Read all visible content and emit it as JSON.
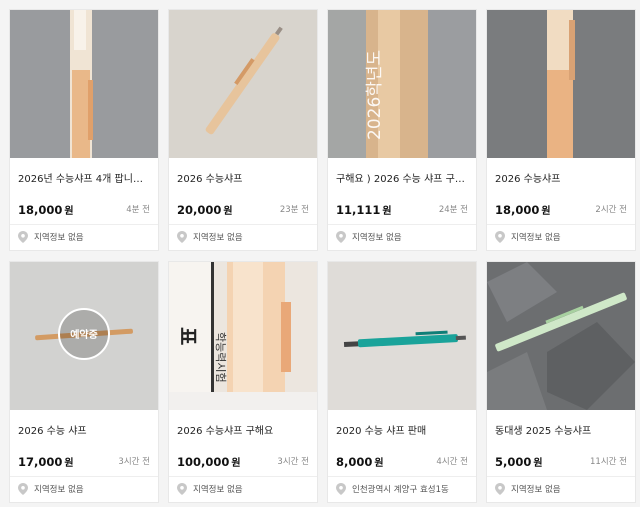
{
  "products": [
    {
      "title": "2026년 수능샤프 4개 팝니다…",
      "price": "18,000",
      "currency": "원",
      "time": "4분 전",
      "location": "지역정보 없음"
    },
    {
      "title": "2026 수능샤프",
      "price": "20,000",
      "currency": "원",
      "time": "23분 전",
      "location": "지역정보 없음"
    },
    {
      "title": "구해요 ) 2026 수능 샤프 구…",
      "price": "11,111",
      "currency": "원",
      "time": "24분 전",
      "location": "지역정보 없음"
    },
    {
      "title": "2026 수능샤프",
      "price": "18,000",
      "currency": "원",
      "time": "2시간 전",
      "location": "지역정보 없음"
    },
    {
      "title": "2026 수능 샤프",
      "price": "17,000",
      "currency": "원",
      "time": "3시간 전",
      "location": "지역정보 없음",
      "badge": "예약중"
    },
    {
      "title": "2026 수능샤프 구해요",
      "price": "100,000",
      "currency": "원",
      "time": "3시간 전",
      "location": "지역정보 없음"
    },
    {
      "title": "2020 수능 샤프 판매",
      "price": "8,000",
      "currency": "원",
      "time": "4시간 전",
      "location": "인천광역시 계양구 효성1동"
    },
    {
      "title": "동대생 2025 수능샤프",
      "price": "5,000",
      "currency": "원",
      "time": "11시간 전",
      "location": "지역정보 없음"
    }
  ],
  "photo_text": {
    "pencil_barrel": "2026학년도",
    "exam_sheet": "학능력시험",
    "exam_mark": "표"
  },
  "colors": {
    "price": "#111111",
    "muted": "#888888",
    "pin": "#c8c8c8"
  }
}
